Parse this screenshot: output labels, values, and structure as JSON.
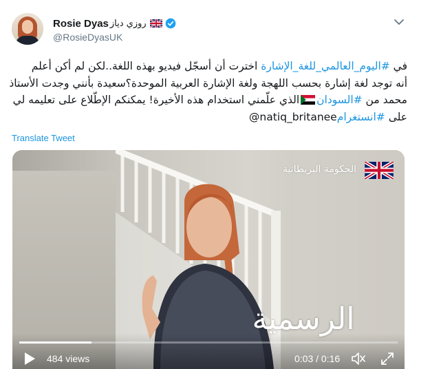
{
  "author": {
    "display_name": "Rosie Dyas",
    "arabic_name": "روزي دياز",
    "handle": "@RosieDyasUK",
    "flag_icon": "uk-flag-icon",
    "verified_icon": "verified-badge-icon",
    "verified_color": "#1da1f2"
  },
  "tweet": {
    "line1_pre": "في ",
    "line1_hashtag": "#اليوم_العالمي_للغة_الإشارة",
    "line1_post": " اخترت أن أسجّل فيديو بهذه اللغة..لكن لم أكن أعلم",
    "line2": "أنه توجد لغة إشارة بحسب اللهجة ولغة الإشارة العربية الموحدة؟سعيدة بأنني وجدت الأستاذ",
    "line3_pre": "محمد من ",
    "line3_hashtag": "#السودان",
    "line3_post": "الذي علّمني استخدام هذه الأخيرة! يمكنكم الإطّلاع على تعليمه لي",
    "line4_pre": "على ",
    "line4_hashtag": "#انستغرام",
    "line4_mention": " @natiq_britanee",
    "flag_icon": "sudan-flag-icon",
    "link_color": "#1b95e0"
  },
  "translate_label": "Translate Tweet",
  "video": {
    "watermark_text": "الحكومة البريطانية",
    "caption": "الرسمية",
    "views": "484 views",
    "time": "0:03 / 0:16",
    "progress_fraction": 0.19,
    "play_icon": "play-icon",
    "volume_icon": "volume-icon",
    "fullscreen_icon": "fullscreen-icon"
  }
}
